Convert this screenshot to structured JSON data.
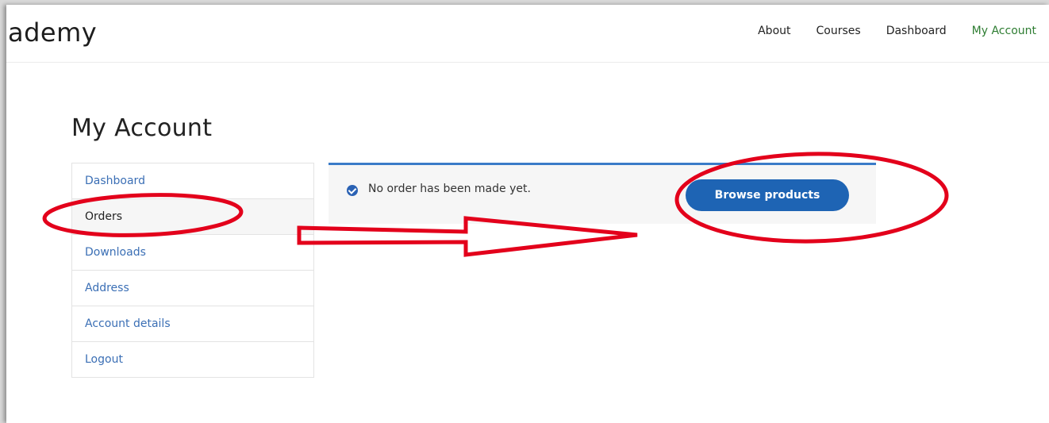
{
  "header": {
    "site_title": "ademy",
    "nav": [
      {
        "label": "About"
      },
      {
        "label": "Courses"
      },
      {
        "label": "Dashboard"
      },
      {
        "label": "My Account",
        "active": true
      }
    ]
  },
  "page": {
    "title": "My Account"
  },
  "account_menu": {
    "items": [
      {
        "label": "Dashboard"
      },
      {
        "label": "Orders",
        "active": true
      },
      {
        "label": "Downloads"
      },
      {
        "label": "Address"
      },
      {
        "label": "Account details"
      },
      {
        "label": "Logout"
      }
    ]
  },
  "notice": {
    "message": "No order has been made yet.",
    "button_label": "Browse products",
    "icon": "check-circle-icon"
  },
  "colors": {
    "link": "#3b6fb5",
    "active_nav": "#2e7d32",
    "button": "#1e64b4",
    "notice_border": "#3a7bc8",
    "annotation": "#e3001b"
  }
}
